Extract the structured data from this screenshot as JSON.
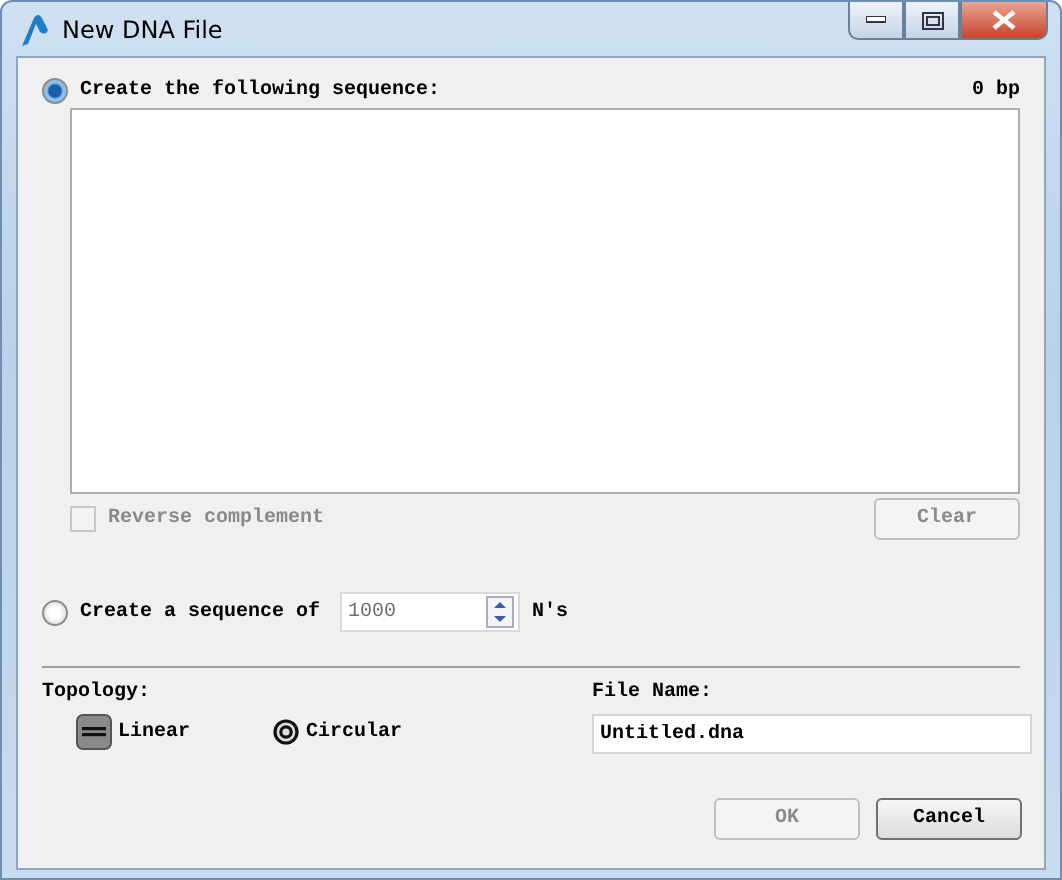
{
  "window": {
    "title": "New DNA File"
  },
  "sequence_option": {
    "label": "Create the following sequence:",
    "selected": true,
    "length": "0 bp"
  },
  "reverse_complement": {
    "label": "Reverse complement",
    "checked": false,
    "disabled": true
  },
  "clear_button": {
    "label": "Clear",
    "disabled": true
  },
  "ns_option": {
    "label": "Create a sequence of",
    "selected": false,
    "value": "1000",
    "suffix": "N's"
  },
  "topology": {
    "label": "Topology:",
    "options": [
      {
        "kind": "linear",
        "label": "Linear",
        "selected": true
      },
      {
        "kind": "circular",
        "label": "Circular",
        "selected": false
      }
    ]
  },
  "file_name": {
    "label": "File Name:",
    "value": "Untitled.dna"
  },
  "buttons": [
    {
      "label": "OK",
      "disabled": true
    },
    {
      "label": "Cancel",
      "disabled": false
    }
  ]
}
